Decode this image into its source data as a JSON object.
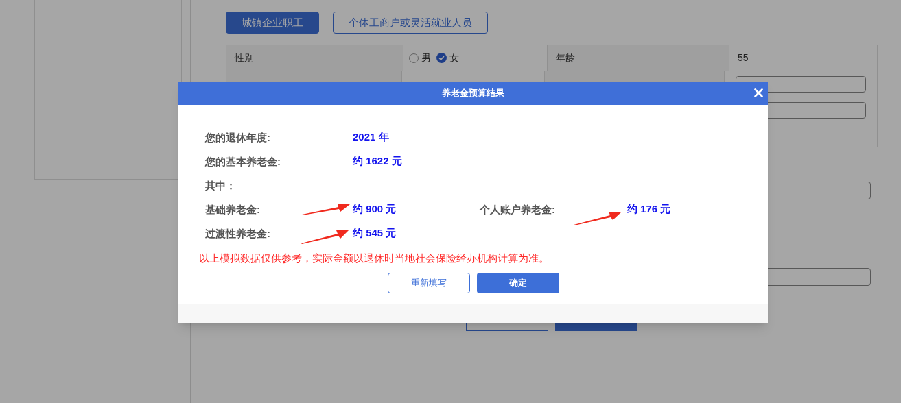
{
  "background": {
    "insurance_types": [
      {
        "label": "城镇企业职工",
        "selected": true
      },
      {
        "label": "个体工商户或灵活就业人员",
        "selected": false
      }
    ],
    "form_row": {
      "gender_label": "性别",
      "gender_options": [
        {
          "label": "男",
          "selected": false
        },
        {
          "label": "女",
          "selected": true
        }
      ],
      "age_label": "年龄",
      "age_value": "55"
    }
  },
  "dialog": {
    "title": "养老金预算结果",
    "rows": [
      [
        {
          "label": "您的退休年度:",
          "value": "2021 年"
        }
      ],
      [
        {
          "label": "您的基本养老金:",
          "value": "约 1622 元"
        }
      ],
      [
        {
          "label": "其中："
        }
      ],
      [
        {
          "label": "基础养老金:",
          "value": "约 900 元"
        },
        {
          "label": "个人账户养老金:",
          "value": "约 176 元"
        }
      ],
      [
        {
          "label": "过渡性养老金:",
          "value": "约 545 元"
        }
      ]
    ],
    "note": "以上模拟数据仅供参考，实际金额以退休时当地社会保险经办机构计算为准。",
    "buttons": [
      {
        "label": "重新填写",
        "kind": "secondary"
      },
      {
        "label": "确定",
        "kind": "primary"
      }
    ]
  }
}
